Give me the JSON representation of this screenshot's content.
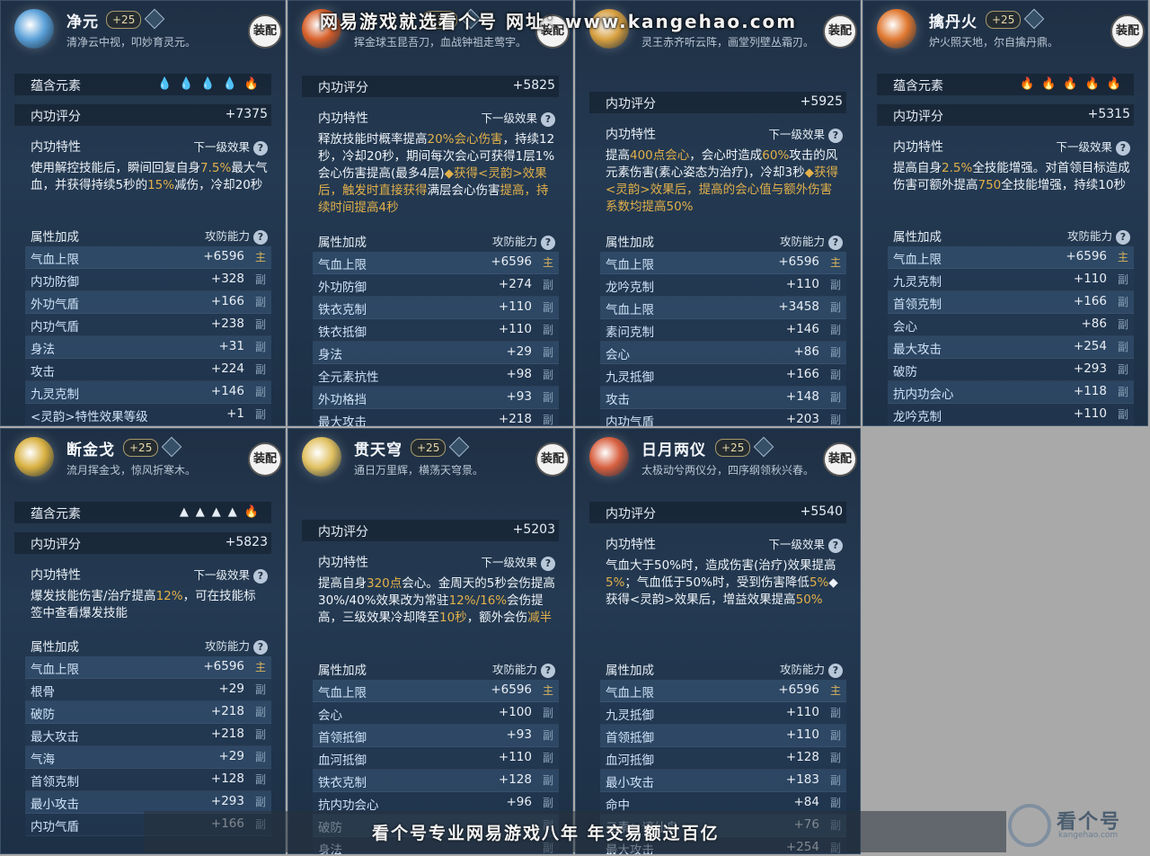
{
  "watermark_top": "网易游戏就选看个号 网址：www.kangehao.com",
  "bottom_banner": "看个号专业网易游戏八年 年交易额过百亿",
  "logo": {
    "name": "看个号",
    "domain": "kangehao.com"
  },
  "colors": {
    "highlight": "#e2b04a",
    "panel_bg": "#243a52",
    "main_tag": "#d7b25c"
  },
  "cards": [
    {
      "title": "净元",
      "level": "+25",
      "subtitle": "清净云中视，叩妙育灵元。",
      "equip": "装配",
      "emblem_color": "#5aa0d8",
      "element_label": "蕴含元素",
      "element_icons": "💧💧💧💧🔥",
      "score_label": "内功评分",
      "score": "+7375",
      "trait_label": "内功特性",
      "next_label": "下一级效果",
      "desc": [
        "使用解控技能后，瞬间回复自身",
        "7.5%",
        "最大气血，并获得持续5秒的",
        "15%",
        "减伤，冷却20秒"
      ],
      "attr_label": "属性加成",
      "attr_right": "攻防能力",
      "attrs": [
        {
          "name": "气血上限",
          "value": "+6596",
          "tag": "主"
        },
        {
          "name": "内功防御",
          "value": "+328",
          "tag": "副"
        },
        {
          "name": "外功气盾",
          "value": "+166",
          "tag": "副"
        },
        {
          "name": "内功气盾",
          "value": "+238",
          "tag": "副"
        },
        {
          "name": "身法",
          "value": "+31",
          "tag": "副"
        },
        {
          "name": "攻击",
          "value": "+224",
          "tag": "副"
        },
        {
          "name": "九灵克制",
          "value": "+146",
          "tag": "副"
        },
        {
          "name": "<灵韵>特性效果等级",
          "value": "+1",
          "tag": "副"
        }
      ]
    },
    {
      "title": "",
      "level": "+25",
      "subtitle": "挥金球玉昆吾刀，血战钟祖走莺宇。",
      "equip": "装配",
      "emblem_color": "#d8602a",
      "score_label": "内功评分",
      "score": "+5825",
      "trait_label": "内功特性",
      "next_label": "下一级效果",
      "desc": [
        "释放技能时概率提高",
        "20%会心伤害",
        "，持续12秒，冷却20秒，期间每次会心可获得1层1%会心伤害提高(最多4层)",
        "◆获得<灵韵>效果后，触发时直接获得",
        "满层会心伤害",
        "提高，持续时间提高4秒"
      ],
      "attr_label": "属性加成",
      "attr_right": "攻防能力",
      "attrs": [
        {
          "name": "气血上限",
          "value": "+6596",
          "tag": "主"
        },
        {
          "name": "外功防御",
          "value": "+274",
          "tag": "副"
        },
        {
          "name": "铁衣克制",
          "value": "+110",
          "tag": "副"
        },
        {
          "name": "铁衣抵御",
          "value": "+110",
          "tag": "副"
        },
        {
          "name": "身法",
          "value": "+29",
          "tag": "副"
        },
        {
          "name": "全元素抗性",
          "value": "+98",
          "tag": "副"
        },
        {
          "name": "外功格挡",
          "value": "+93",
          "tag": "副"
        },
        {
          "name": "最大攻击",
          "value": "+218",
          "tag": "副"
        }
      ]
    },
    {
      "title": "",
      "level": "",
      "subtitle": "灵王赤齐听云阵，画堂列壁丛霜刃。",
      "equip": "装配",
      "emblem_color": "#d8a040",
      "score_label": "内功评分",
      "score": "+5925",
      "trait_label": "内功特性",
      "next_label": "下一级效果",
      "desc": [
        "提高",
        "400点会心",
        "，会心时造成",
        "60%",
        "攻击的风元素伤害(素心姿态为治疗)，冷却3秒",
        "◆获得<灵韵>效果后，提高的会心值与额外伤害系数均提高50%"
      ],
      "attr_label": "属性加成",
      "attr_right": "攻防能力",
      "attrs": [
        {
          "name": "气血上限",
          "value": "+6596",
          "tag": "主"
        },
        {
          "name": "龙吟克制",
          "value": "+110",
          "tag": "副"
        },
        {
          "name": "气血上限",
          "value": "+3458",
          "tag": "副"
        },
        {
          "name": "素问克制",
          "value": "+146",
          "tag": "副"
        },
        {
          "name": "会心",
          "value": "+86",
          "tag": "副"
        },
        {
          "name": "九灵抵御",
          "value": "+166",
          "tag": "副"
        },
        {
          "name": "攻击",
          "value": "+148",
          "tag": "副"
        },
        {
          "name": "内功气盾",
          "value": "+203",
          "tag": "副"
        }
      ]
    },
    {
      "title": "擒丹火",
      "level": "+25",
      "subtitle": "炉火照天地，尔自擒丹鼎。",
      "equip": "装配",
      "emblem_color": "#e07830",
      "element_label": "蕴含元素",
      "element_icons": "🔥🔥🔥🔥🔥",
      "score_label": "内功评分",
      "score": "+5315",
      "trait_label": "内功特性",
      "next_label": "下一级效果",
      "desc": [
        "提高自身",
        "2.5%",
        "全技能增强。对首领目标造成伤害可额外提高",
        "750",
        "全技能增强，持续10秒"
      ],
      "attr_label": "属性加成",
      "attr_right": "攻防能力",
      "attrs": [
        {
          "name": "气血上限",
          "value": "+6596",
          "tag": "主"
        },
        {
          "name": "九灵克制",
          "value": "+110",
          "tag": "副"
        },
        {
          "name": "首领克制",
          "value": "+166",
          "tag": "副"
        },
        {
          "name": "会心",
          "value": "+86",
          "tag": "副"
        },
        {
          "name": "最大攻击",
          "value": "+254",
          "tag": "副"
        },
        {
          "name": "破防",
          "value": "+293",
          "tag": "副"
        },
        {
          "name": "抗内功会心",
          "value": "+118",
          "tag": "副"
        },
        {
          "name": "龙吟克制",
          "value": "+110",
          "tag": "副"
        }
      ]
    },
    {
      "title": "断金戈",
      "level": "+25",
      "subtitle": "流月挥金戈，惊风折寒木。",
      "equip": "装配",
      "emblem_color": "#d8b040",
      "element_label": "蕴含元素",
      "element_icons": "▲▲▲▲🔥",
      "score_label": "内功评分",
      "score": "+5823",
      "trait_label": "内功特性",
      "next_label": "下一级效果",
      "desc": [
        "爆发技能伤害/治疗提高",
        "12%",
        "，可在技能标签中查看爆发技能"
      ],
      "attr_label": "属性加成",
      "attr_right": "攻防能力",
      "attrs": [
        {
          "name": "气血上限",
          "value": "+6596",
          "tag": "主"
        },
        {
          "name": "根骨",
          "value": "+29",
          "tag": "副"
        },
        {
          "name": "破防",
          "value": "+218",
          "tag": "副"
        },
        {
          "name": "最大攻击",
          "value": "+218",
          "tag": "副"
        },
        {
          "name": "气海",
          "value": "+29",
          "tag": "副"
        },
        {
          "name": "首领克制",
          "value": "+128",
          "tag": "副"
        },
        {
          "name": "最小攻击",
          "value": "+293",
          "tag": "副"
        },
        {
          "name": "内功气盾",
          "value": "+166",
          "tag": "副"
        }
      ]
    },
    {
      "title": "贯天穹",
      "level": "+25",
      "subtitle": "通日万里辉，横荡天穹景。",
      "equip": "装配",
      "emblem_color": "#e0c060",
      "score_label": "内功评分",
      "score": "+5203",
      "trait_label": "内功特性",
      "next_label": "下一级效果",
      "desc": [
        "提高自身",
        "320点",
        "会心。金周天的5秒会伤提高30%/40%效果改为常驻",
        "12%/16%",
        "会伤提高，三级效果冷却降至",
        "10秒",
        "，额外会伤",
        "减半"
      ],
      "attr_label": "属性加成",
      "attr_right": "攻防能力",
      "attrs": [
        {
          "name": "气血上限",
          "value": "+6596",
          "tag": "主"
        },
        {
          "name": "会心",
          "value": "+100",
          "tag": "副"
        },
        {
          "name": "首领抵御",
          "value": "+93",
          "tag": "副"
        },
        {
          "name": "血河抵御",
          "value": "+110",
          "tag": "副"
        },
        {
          "name": "铁衣克制",
          "value": "+128",
          "tag": "副"
        },
        {
          "name": "抗内功会心",
          "value": "+96",
          "tag": "副"
        },
        {
          "name": "破防",
          "value": "",
          "tag": "副"
        },
        {
          "name": "身法",
          "value": "",
          "tag": "副"
        }
      ]
    },
    {
      "title": "日月两仪",
      "level": "+25",
      "subtitle": "太极动兮两仪分，四序纲领秋兴春。",
      "equip": "装配",
      "emblem_color": "#d86040",
      "score_label": "内功评分",
      "score": "+5540",
      "trait_label": "内功特性",
      "next_label": "下一级效果",
      "desc": [
        "气血大于50%时，造成伤害(治疗)效果提高",
        "5%",
        "；气血低于50%时，受到伤害降低",
        "5%",
        "◆获得<灵韵>效果后，增益效果提高",
        "50%"
      ],
      "attr_label": "属性加成",
      "attr_right": "攻防能力",
      "attrs": [
        {
          "name": "气血上限",
          "value": "+6596",
          "tag": "主"
        },
        {
          "name": "九灵抵御",
          "value": "+110",
          "tag": "副"
        },
        {
          "name": "首领抵御",
          "value": "+110",
          "tag": "副"
        },
        {
          "name": "血河抵御",
          "value": "+128",
          "tag": "副"
        },
        {
          "name": "最小攻击",
          "value": "+183",
          "tag": "副"
        },
        {
          "name": "命中",
          "value": "+84",
          "tag": "副"
        },
        {
          "name": "元素：谪仙岛",
          "value": "+76",
          "tag": "副"
        },
        {
          "name": "最大攻击",
          "value": "+254",
          "tag": "副"
        }
      ]
    }
  ]
}
